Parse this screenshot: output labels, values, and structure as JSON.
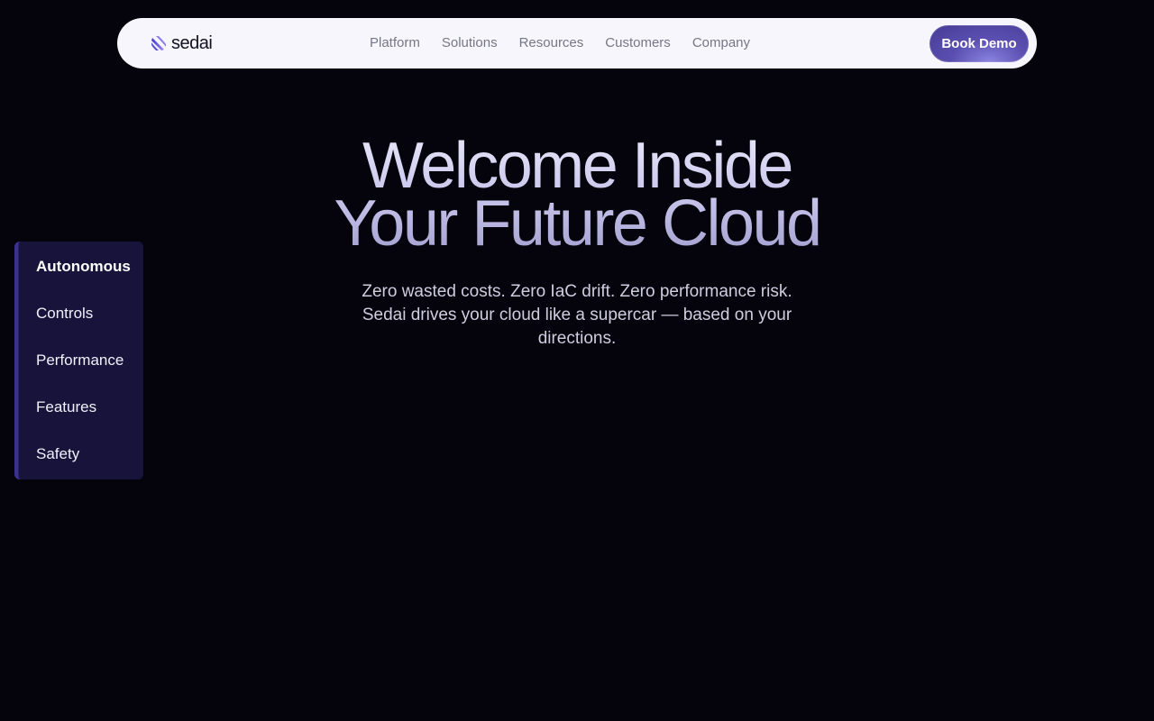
{
  "brand": {
    "name": "sedai",
    "accent": "#5a4fb0"
  },
  "nav": {
    "links": [
      {
        "label": "Platform"
      },
      {
        "label": "Solutions"
      },
      {
        "label": "Resources"
      },
      {
        "label": "Customers"
      },
      {
        "label": "Company"
      }
    ],
    "cta_label": "Book Demo"
  },
  "hero": {
    "title_line1": "Welcome Inside",
    "title_line2": "Your Future Cloud",
    "subtitle": "Zero wasted costs. Zero IaC drift. Zero performance risk. Sedai drives your cloud like a supercar — based on your directions."
  },
  "side_menu": {
    "items": [
      {
        "label": "Autonomous",
        "active": true
      },
      {
        "label": "Controls",
        "active": false
      },
      {
        "label": "Performance",
        "active": false
      },
      {
        "label": "Features",
        "active": false
      },
      {
        "label": "Safety",
        "active": false
      }
    ]
  },
  "icons": {
    "logo": "sedai-logo-icon"
  },
  "colors": {
    "background": "#05040c",
    "navbar": "#f6f6fc",
    "side_menu_bg": "#17133a",
    "side_menu_border": "#3b3290"
  }
}
